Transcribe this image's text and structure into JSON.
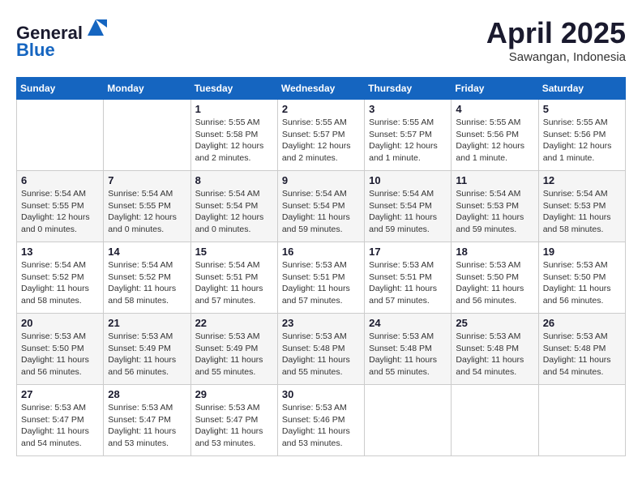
{
  "header": {
    "logo_line1": "General",
    "logo_line2": "Blue",
    "month": "April 2025",
    "location": "Sawangan, Indonesia"
  },
  "weekdays": [
    "Sunday",
    "Monday",
    "Tuesday",
    "Wednesday",
    "Thursday",
    "Friday",
    "Saturday"
  ],
  "weeks": [
    [
      {
        "day": "",
        "info": ""
      },
      {
        "day": "",
        "info": ""
      },
      {
        "day": "1",
        "info": "Sunrise: 5:55 AM\nSunset: 5:58 PM\nDaylight: 12 hours and 2 minutes."
      },
      {
        "day": "2",
        "info": "Sunrise: 5:55 AM\nSunset: 5:57 PM\nDaylight: 12 hours and 2 minutes."
      },
      {
        "day": "3",
        "info": "Sunrise: 5:55 AM\nSunset: 5:57 PM\nDaylight: 12 hours and 1 minute."
      },
      {
        "day": "4",
        "info": "Sunrise: 5:55 AM\nSunset: 5:56 PM\nDaylight: 12 hours and 1 minute."
      },
      {
        "day": "5",
        "info": "Sunrise: 5:55 AM\nSunset: 5:56 PM\nDaylight: 12 hours and 1 minute."
      }
    ],
    [
      {
        "day": "6",
        "info": "Sunrise: 5:54 AM\nSunset: 5:55 PM\nDaylight: 12 hours and 0 minutes."
      },
      {
        "day": "7",
        "info": "Sunrise: 5:54 AM\nSunset: 5:55 PM\nDaylight: 12 hours and 0 minutes."
      },
      {
        "day": "8",
        "info": "Sunrise: 5:54 AM\nSunset: 5:54 PM\nDaylight: 12 hours and 0 minutes."
      },
      {
        "day": "9",
        "info": "Sunrise: 5:54 AM\nSunset: 5:54 PM\nDaylight: 11 hours and 59 minutes."
      },
      {
        "day": "10",
        "info": "Sunrise: 5:54 AM\nSunset: 5:54 PM\nDaylight: 11 hours and 59 minutes."
      },
      {
        "day": "11",
        "info": "Sunrise: 5:54 AM\nSunset: 5:53 PM\nDaylight: 11 hours and 59 minutes."
      },
      {
        "day": "12",
        "info": "Sunrise: 5:54 AM\nSunset: 5:53 PM\nDaylight: 11 hours and 58 minutes."
      }
    ],
    [
      {
        "day": "13",
        "info": "Sunrise: 5:54 AM\nSunset: 5:52 PM\nDaylight: 11 hours and 58 minutes."
      },
      {
        "day": "14",
        "info": "Sunrise: 5:54 AM\nSunset: 5:52 PM\nDaylight: 11 hours and 58 minutes."
      },
      {
        "day": "15",
        "info": "Sunrise: 5:54 AM\nSunset: 5:51 PM\nDaylight: 11 hours and 57 minutes."
      },
      {
        "day": "16",
        "info": "Sunrise: 5:53 AM\nSunset: 5:51 PM\nDaylight: 11 hours and 57 minutes."
      },
      {
        "day": "17",
        "info": "Sunrise: 5:53 AM\nSunset: 5:51 PM\nDaylight: 11 hours and 57 minutes."
      },
      {
        "day": "18",
        "info": "Sunrise: 5:53 AM\nSunset: 5:50 PM\nDaylight: 11 hours and 56 minutes."
      },
      {
        "day": "19",
        "info": "Sunrise: 5:53 AM\nSunset: 5:50 PM\nDaylight: 11 hours and 56 minutes."
      }
    ],
    [
      {
        "day": "20",
        "info": "Sunrise: 5:53 AM\nSunset: 5:50 PM\nDaylight: 11 hours and 56 minutes."
      },
      {
        "day": "21",
        "info": "Sunrise: 5:53 AM\nSunset: 5:49 PM\nDaylight: 11 hours and 56 minutes."
      },
      {
        "day": "22",
        "info": "Sunrise: 5:53 AM\nSunset: 5:49 PM\nDaylight: 11 hours and 55 minutes."
      },
      {
        "day": "23",
        "info": "Sunrise: 5:53 AM\nSunset: 5:48 PM\nDaylight: 11 hours and 55 minutes."
      },
      {
        "day": "24",
        "info": "Sunrise: 5:53 AM\nSunset: 5:48 PM\nDaylight: 11 hours and 55 minutes."
      },
      {
        "day": "25",
        "info": "Sunrise: 5:53 AM\nSunset: 5:48 PM\nDaylight: 11 hours and 54 minutes."
      },
      {
        "day": "26",
        "info": "Sunrise: 5:53 AM\nSunset: 5:48 PM\nDaylight: 11 hours and 54 minutes."
      }
    ],
    [
      {
        "day": "27",
        "info": "Sunrise: 5:53 AM\nSunset: 5:47 PM\nDaylight: 11 hours and 54 minutes."
      },
      {
        "day": "28",
        "info": "Sunrise: 5:53 AM\nSunset: 5:47 PM\nDaylight: 11 hours and 53 minutes."
      },
      {
        "day": "29",
        "info": "Sunrise: 5:53 AM\nSunset: 5:47 PM\nDaylight: 11 hours and 53 minutes."
      },
      {
        "day": "30",
        "info": "Sunrise: 5:53 AM\nSunset: 5:46 PM\nDaylight: 11 hours and 53 minutes."
      },
      {
        "day": "",
        "info": ""
      },
      {
        "day": "",
        "info": ""
      },
      {
        "day": "",
        "info": ""
      }
    ]
  ]
}
